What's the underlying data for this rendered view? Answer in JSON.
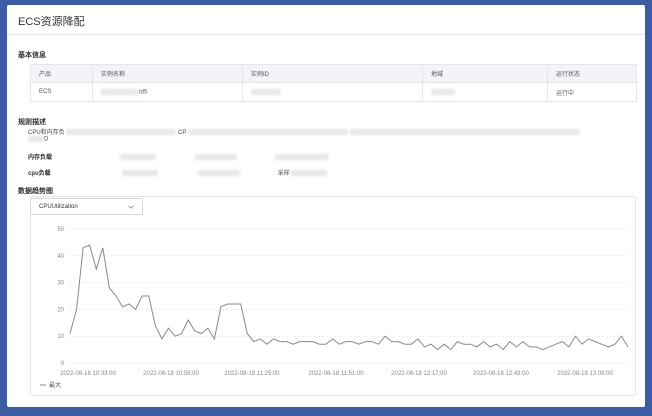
{
  "window": {
    "title": "ECS资源降配"
  },
  "sections": {
    "basic_info": "基本信息",
    "rule_desc": "规则描述",
    "trend": "数据趋势图"
  },
  "table": {
    "headers": [
      "产品",
      "实例名称",
      "实例ID",
      "地域",
      "运行状态"
    ],
    "row": {
      "product": "ECS",
      "name_suffix": "td5",
      "status": "运行中"
    }
  },
  "rules": {
    "line1_prefix": "CPU和内存负",
    "line1_mid": "CP",
    "line2": "D",
    "memory_label": "内存负载",
    "cpu_label": "cpu负载",
    "cpu_extra": "采样"
  },
  "metric_select": {
    "value": "CPUUtilization"
  },
  "colors": {
    "line": "#8a8a8a",
    "accent": "#3c5da3"
  },
  "icons": {
    "dropdown": "chevron-down-icon"
  },
  "chart_data": {
    "type": "line",
    "ylim": [
      0,
      50
    ],
    "yticks": [
      0,
      10,
      20,
      30,
      40,
      50
    ],
    "xticks": [
      "2022-08-18 10:33:00",
      "2022-08-18 10:59:00",
      "2022-08-18 11:25:00",
      "2022-08-18 11:51:00",
      "2022-08-18 12:17:00",
      "2022-08-18 12:43:00",
      "2022-08-18 13:09:00"
    ],
    "xlim": [
      0,
      170
    ],
    "legend": "top-left-bottom",
    "series": [
      {
        "name": "最大",
        "x": [
          0,
          2,
          4,
          6,
          8,
          10,
          12,
          14,
          16,
          18,
          20,
          22,
          24,
          26,
          28,
          30,
          32,
          34,
          36,
          38,
          40,
          42,
          44,
          46,
          48,
          50,
          52,
          54,
          56,
          58,
          60,
          62,
          64,
          66,
          68,
          70,
          72,
          74,
          76,
          78,
          80,
          82,
          84,
          86,
          88,
          90,
          92,
          94,
          96,
          98,
          100,
          102,
          104,
          106,
          108,
          110,
          112,
          114,
          116,
          118,
          120,
          122,
          124,
          126,
          128,
          130,
          132,
          134,
          136,
          138,
          140,
          142,
          144,
          146,
          148,
          150,
          152,
          154,
          156,
          158,
          160,
          162,
          164,
          166,
          168,
          170
        ],
        "values": [
          11,
          20,
          43,
          44,
          35,
          43,
          28,
          25,
          21,
          22,
          20,
          25,
          25,
          14,
          9,
          13,
          10,
          11,
          16,
          12,
          11,
          13,
          9,
          21,
          22,
          22,
          22,
          11,
          8,
          9,
          7,
          9,
          8,
          8,
          7,
          8,
          8,
          8,
          7,
          7,
          9,
          7,
          8,
          8,
          7,
          8,
          8,
          7,
          10,
          8,
          8,
          7,
          7,
          9,
          6,
          7,
          5,
          7,
          5,
          8,
          7,
          7,
          6,
          8,
          6,
          7,
          5,
          8,
          6,
          8,
          6,
          6,
          5,
          6,
          7,
          8,
          6,
          10,
          7,
          9,
          8,
          7,
          6,
          7,
          10,
          6
        ]
      }
    ]
  }
}
